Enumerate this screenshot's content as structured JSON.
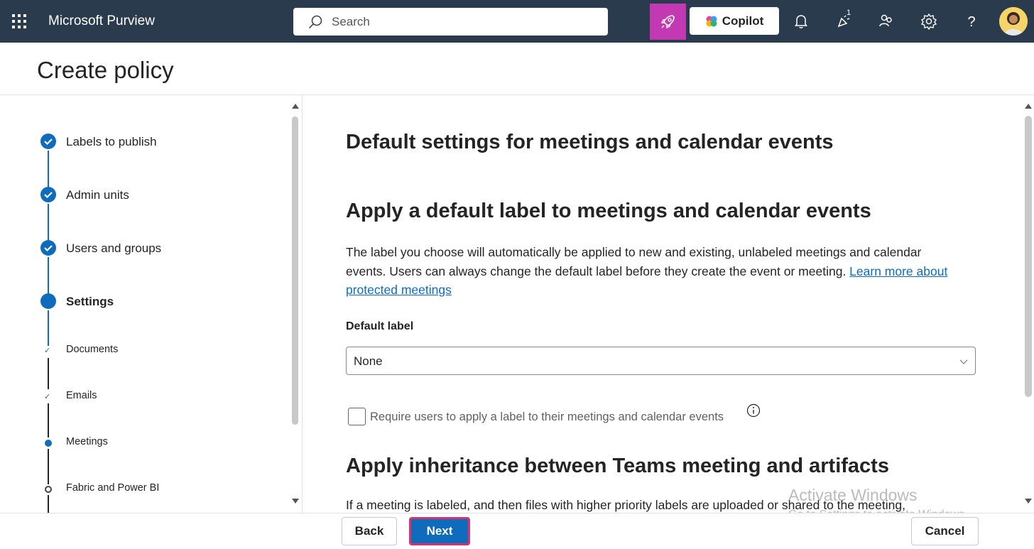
{
  "topbar": {
    "app_title": "Microsoft Purview",
    "search_placeholder": "Search",
    "copilot_label": "Copilot",
    "notification_badge": "1"
  },
  "page": {
    "title": "Create policy"
  },
  "steps": [
    {
      "label": "Labels to publish",
      "state": "done"
    },
    {
      "label": "Admin units",
      "state": "done"
    },
    {
      "label": "Users and groups",
      "state": "done"
    },
    {
      "label": "Settings",
      "state": "current"
    }
  ],
  "substeps": [
    {
      "label": "Documents",
      "state": "done"
    },
    {
      "label": "Emails",
      "state": "done"
    },
    {
      "label": "Meetings",
      "state": "current"
    },
    {
      "label": "Fabric and Power BI",
      "state": "pending"
    }
  ],
  "content": {
    "heading": "Default settings for meetings and calendar events",
    "section1_title": "Apply a default label to meetings and calendar events",
    "section1_text": "The label you choose will automatically be applied to new and existing, unlabeled meetings and calendar events. Users can always change the default label before they create the event or meeting. ",
    "section1_link": "Learn more about protected meetings",
    "default_label_title": "Default label",
    "default_label_value": "None",
    "require_label_text": "Require users to apply a label to their meetings and calendar events",
    "section2_title": "Apply inheritance between Teams meeting and artifacts",
    "section2_text": "If a meeting is labeled, and then files with higher priority labels are uploaded or shared to the meeting,"
  },
  "watermark": {
    "line1": "Activate Windows",
    "line2": "Go to Settings to activate Windows."
  },
  "footer": {
    "back": "Back",
    "next": "Next",
    "cancel": "Cancel"
  },
  "colors": {
    "topbar_bg": "#2b3b4e",
    "accent": "#0f6cbd",
    "rocket_bg": "#c239b3",
    "next_highlight": "#d8336a"
  }
}
